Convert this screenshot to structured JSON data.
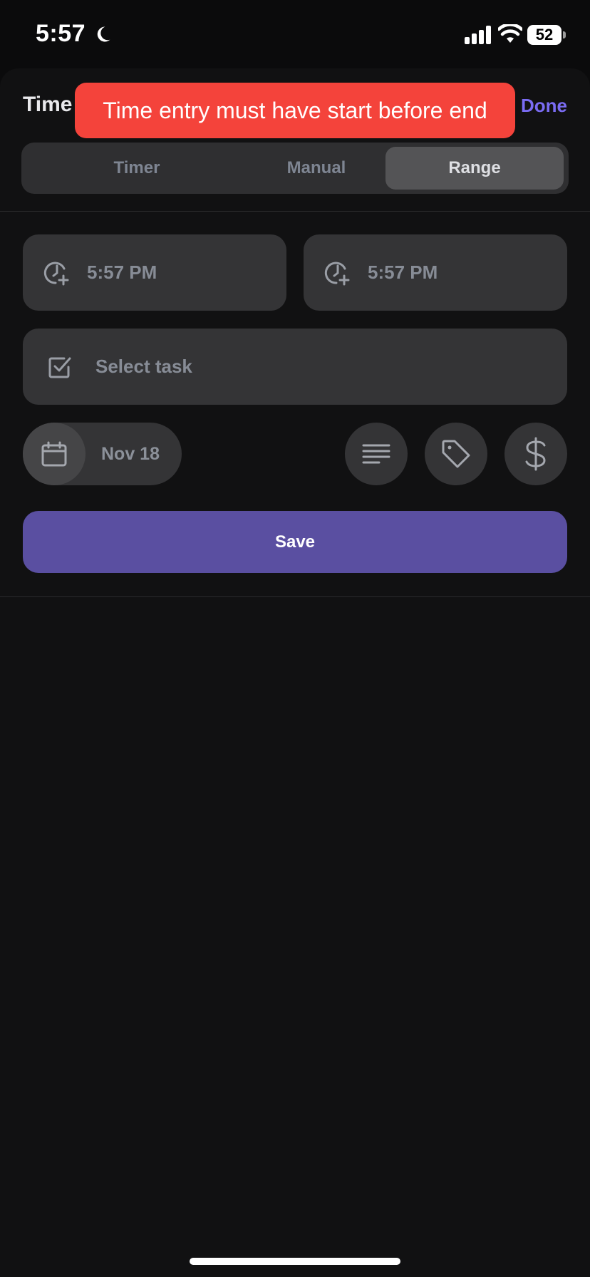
{
  "status_bar": {
    "time": "5:57",
    "battery": "52",
    "icons": [
      "moon-icon",
      "signal-icon",
      "wifi-icon",
      "battery-icon"
    ]
  },
  "header": {
    "title": "Time",
    "done_label": "Done",
    "accent_color": "#7a6cf3"
  },
  "toast": {
    "message": "Time entry must have start before end",
    "color": "#f4433b"
  },
  "tabs": [
    {
      "label": "Timer",
      "selected": false
    },
    {
      "label": "Manual",
      "selected": false
    },
    {
      "label": "Range",
      "selected": true
    }
  ],
  "range": {
    "start_time": "5:57 PM",
    "end_time": "5:57 PM"
  },
  "task": {
    "placeholder": "Select task"
  },
  "date": {
    "label": "Nov 18"
  },
  "actions": {
    "icons": [
      "description-icon",
      "tag-icon",
      "dollar-icon"
    ]
  },
  "save_button": {
    "label": "Save",
    "color": "#5a4fa1"
  }
}
